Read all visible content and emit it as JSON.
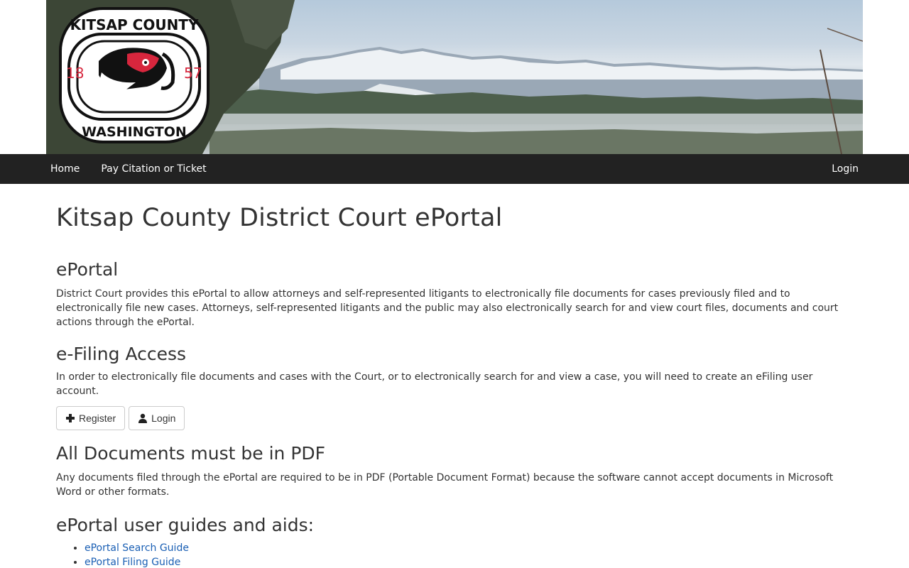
{
  "banner": {
    "seal_text": {
      "top": "KITSAP COUNTY",
      "bottom": "WASHINGTON",
      "year_left": "18",
      "year_right": "57"
    }
  },
  "nav": {
    "links": [
      {
        "label": "Home"
      },
      {
        "label": "Pay Citation or Ticket"
      }
    ],
    "login_label": "Login"
  },
  "main": {
    "title": "Kitsap County District Court ePortal",
    "sections": {
      "eportal": {
        "heading": "ePortal",
        "text": "District Court provides this ePortal to allow attorneys and self-represented litigants to electronically file documents for cases previously filed and to electronically file new cases. Attorneys, self-represented litigants and the public may also electronically search for and view court files, documents and court actions through the ePortal."
      },
      "efiling": {
        "heading": "e-Filing Access",
        "text": "In order to electronically file documents and cases with the Court, or to electronically search for and view a case, you will need to create an eFiling user account.",
        "register_label": "Register",
        "login_label": "Login"
      },
      "pdf": {
        "heading": "All Documents must be in PDF",
        "text": "Any documents filed through the ePortal are required to be in PDF (Portable Document Format) because the software cannot accept documents in Microsoft Word or other formats."
      },
      "guides": {
        "heading": "ePortal user guides and aids:",
        "items": [
          {
            "label": "ePortal Search Guide"
          },
          {
            "label": "ePortal Filing Guide"
          }
        ]
      }
    }
  },
  "colors": {
    "navbar": "#222222",
    "link": "#1a5fb4",
    "text": "#333333",
    "seal_red": "#d7263d"
  },
  "icons": {
    "register": "plus-icon",
    "login": "user-icon"
  }
}
